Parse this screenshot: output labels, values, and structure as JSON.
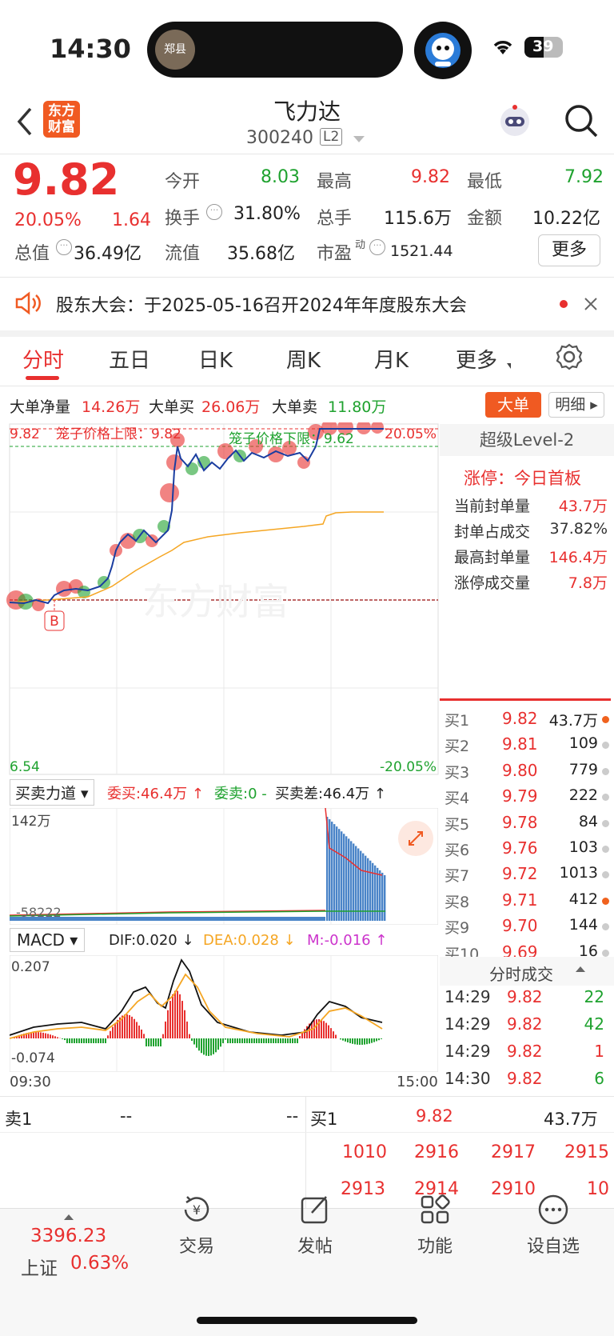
{
  "status_bar": {
    "time": "14:30",
    "island_text": "郑县",
    "battery": "39"
  },
  "header": {
    "logo_line1": "东方",
    "logo_line2": "财富",
    "stock_name": "飞力达",
    "stock_code": "300240",
    "level_badge": "L2"
  },
  "quote": {
    "price": "9.82",
    "change_pct": "20.05%",
    "change": "1.64",
    "open_label": "今开",
    "open": "8.03",
    "high_label": "最高",
    "high": "9.82",
    "low_label": "最低",
    "low": "7.92",
    "turnover_label": "换手",
    "turnover": "31.80%",
    "volume_label": "总手",
    "volume": "115.6万",
    "amount_label": "金额",
    "amount": "10.22亿",
    "mktcap_label": "总值",
    "mktcap": "36.49亿",
    "float_label": "流值",
    "float": "35.68亿",
    "pe_label": "市盈",
    "pe_sup": "动",
    "pe": "1521.44",
    "more": "更多"
  },
  "notice": {
    "text": "股东大会：于2025-05-16召开2024年年度股东大会"
  },
  "tabs": [
    {
      "label": "分时"
    },
    {
      "label": "五日"
    },
    {
      "label": "日K"
    },
    {
      "label": "周K"
    },
    {
      "label": "月K"
    },
    {
      "label": "更多"
    }
  ],
  "bigorder": {
    "net_label": "大单净量",
    "net": "14.26万",
    "buy_label": "大单买",
    "buy": "26.06万",
    "sell_label": "大单卖",
    "sell": "11.80万",
    "btn_big": "大单",
    "btn_detail": "明细"
  },
  "chart": {
    "top_price": "9.82",
    "upper_limit": "笼子价格上限：9.82",
    "lower_limit": "笼子价格下限：9.62",
    "top_pct": "20.05%",
    "bottom_price": "6.54",
    "bottom_pct": "-20.05%",
    "marker": "B",
    "watermark": "东方财富"
  },
  "level2": {
    "title": "超级Level-2",
    "limit_status": "涨停：今日首板",
    "rows": [
      {
        "label": "当前封单量",
        "value": "43.7万"
      },
      {
        "label": "封单占成交",
        "value": "37.82%"
      },
      {
        "label": "最高封单量",
        "value": "146.4万"
      },
      {
        "label": "涨停成交量",
        "value": "7.8万"
      }
    ]
  },
  "orderbook": [
    {
      "label": "买1",
      "price": "9.82",
      "vol": "43.7万",
      "dot": "#f0621e"
    },
    {
      "label": "买2",
      "price": "9.81",
      "vol": "109",
      "dot": "#cccccc"
    },
    {
      "label": "买3",
      "price": "9.80",
      "vol": "779",
      "dot": "#cccccc"
    },
    {
      "label": "买4",
      "price": "9.79",
      "vol": "222",
      "dot": "#cccccc"
    },
    {
      "label": "买5",
      "price": "9.78",
      "vol": "84",
      "dot": "#cccccc"
    },
    {
      "label": "买6",
      "price": "9.76",
      "vol": "103",
      "dot": "#cccccc"
    },
    {
      "label": "买7",
      "price": "9.72",
      "vol": "1013",
      "dot": "#cccccc"
    },
    {
      "label": "买8",
      "price": "9.71",
      "vol": "412",
      "dot": "#f0621e"
    },
    {
      "label": "买9",
      "price": "9.70",
      "vol": "144",
      "dot": "#cccccc"
    },
    {
      "label": "买10",
      "price": "9.69",
      "vol": "16",
      "dot": "#cccccc"
    }
  ],
  "tick_title": "分时成交",
  "ticks": [
    {
      "time": "14:29",
      "price": "9.82",
      "vol": "22",
      "color": "#1fa22f"
    },
    {
      "time": "14:29",
      "price": "9.82",
      "vol": "42",
      "color": "#1fa22f"
    },
    {
      "time": "14:29",
      "price": "9.82",
      "vol": "1",
      "color": "#e8302f"
    },
    {
      "time": "14:30",
      "price": "9.82",
      "vol": "6",
      "color": "#1fa22f"
    }
  ],
  "power": {
    "selector": "买卖力道",
    "commit_buy": "委买:46.4万 ↑",
    "commit_sell": "委卖:0 -",
    "diff": "买卖差:46.4万 ↑",
    "max_label": "142万",
    "min_label": "-58222"
  },
  "macd": {
    "selector": "MACD",
    "dif": "DIF:0.020 ↓",
    "dea": "DEA:0.028 ↓",
    "m": "M:-0.016 ↑",
    "max_label": "0.207",
    "min_label": "-0.074",
    "start_time": "09:30",
    "end_time": "15:00"
  },
  "bottom_queue": {
    "sell_label": "卖1",
    "sell_dash1": "--",
    "sell_dash2": "--",
    "buy_label": "买1",
    "buy_price": "9.82",
    "buy_vol": "43.7万",
    "row1": [
      "1010",
      "2916",
      "2917",
      "2915"
    ],
    "row2": [
      "2913",
      "2914",
      "2910",
      "10"
    ]
  },
  "nav": {
    "index_value": "3396.23",
    "index_name": "上证",
    "index_pct": "0.63%",
    "items": [
      {
        "label": "交易"
      },
      {
        "label": "发帖"
      },
      {
        "label": "功能"
      },
      {
        "label": "设自选"
      }
    ]
  }
}
